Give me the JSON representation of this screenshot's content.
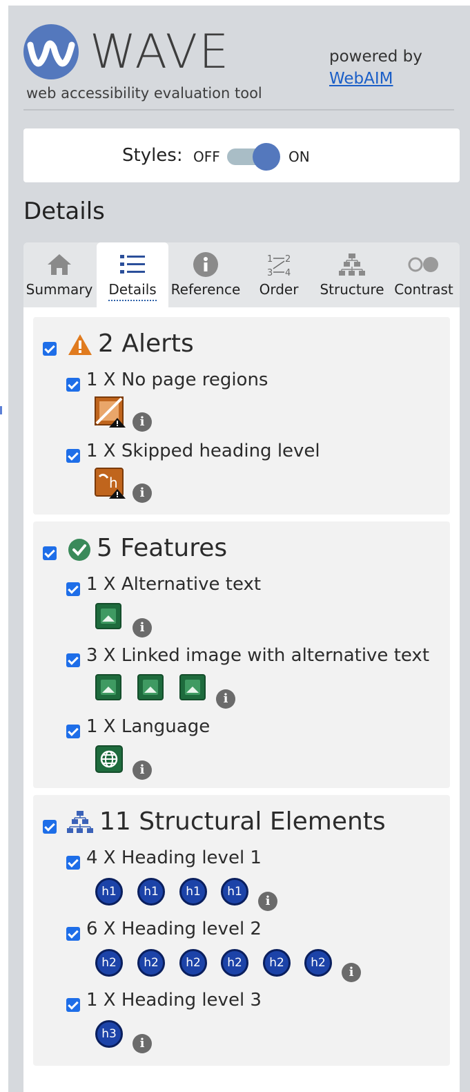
{
  "header": {
    "logo_text": "WAVE",
    "tagline": "web accessibility evaluation tool",
    "powered_by": "powered by",
    "webaim_link": "WebAIM"
  },
  "styles": {
    "label": "Styles:",
    "off": "OFF",
    "on": "ON",
    "state": "on"
  },
  "details_title": "Details",
  "tabs": [
    {
      "label": "Summary",
      "icon": "home-icon"
    },
    {
      "label": "Details",
      "icon": "list-icon",
      "active": true
    },
    {
      "label": "Reference",
      "icon": "info-icon"
    },
    {
      "label": "Order",
      "icon": "order-icon"
    },
    {
      "label": "Structure",
      "icon": "structure-icon"
    },
    {
      "label": "Contrast",
      "icon": "contrast-icon"
    }
  ],
  "sections": {
    "alerts": {
      "title": "2 Alerts",
      "items": [
        {
          "label": "1 X No page regions"
        },
        {
          "label": "1 X Skipped heading level"
        }
      ]
    },
    "features": {
      "title": "5 Features",
      "items": [
        {
          "label": "1 X Alternative text"
        },
        {
          "label": "3 X Linked image with alternative text"
        },
        {
          "label": "1 X Language"
        }
      ]
    },
    "structure": {
      "title": "11 Structural Elements",
      "items": [
        {
          "label": "4 X Heading level 1",
          "badge": "h1"
        },
        {
          "label": "6 X Heading level 2",
          "badge": "h2"
        },
        {
          "label": "1 X Heading level 3",
          "badge": "h3"
        }
      ]
    }
  },
  "colors": {
    "accent": "#5478bd",
    "checkbox": "#1e6ee8",
    "alert": "#e07b1f",
    "feature": "#1e6b3d",
    "structure": "#1c43a8"
  }
}
